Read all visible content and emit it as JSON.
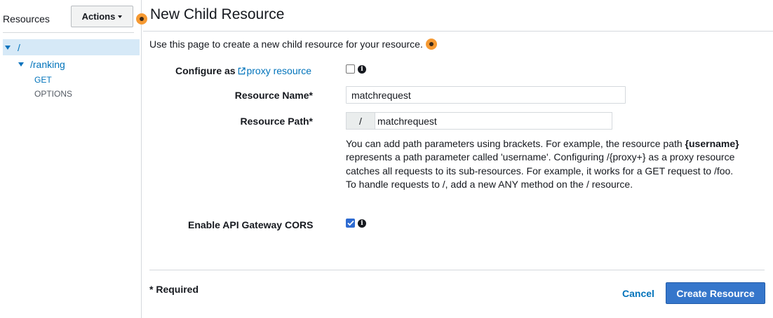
{
  "sidebar": {
    "title": "Resources",
    "actions_label": "Actions",
    "tree": {
      "root_label": "/",
      "child_label": "/ranking",
      "methods": [
        "GET",
        "OPTIONS"
      ]
    }
  },
  "main": {
    "title": "New Child Resource",
    "description": "Use this page to create a new child resource for your resource.",
    "proxy": {
      "label": "Configure as",
      "link_label": "proxy resource",
      "checked": false
    },
    "resource_name": {
      "label": "Resource Name*",
      "value": "matchrequest"
    },
    "resource_path": {
      "label": "Resource Path*",
      "prefix": "/",
      "value": "matchrequest"
    },
    "help": {
      "part1": "You can add path parameters using brackets. For example, the resource path ",
      "bold": "{username}",
      "part2": " represents a path parameter called 'username'. Configuring /{proxy+} as a proxy resource catches all requests to its sub-resources. For example, it works for a GET request to /foo. To handle requests to /, add a new ANY method on the / resource."
    },
    "cors": {
      "label": "Enable API Gateway CORS",
      "checked": true
    },
    "required_note": "* Required",
    "cancel_label": "Cancel",
    "create_label": "Create Resource"
  },
  "icons": {
    "info": "info-icon",
    "external_link": "external-link-icon",
    "help_dot": "orange-info-dot"
  },
  "colors": {
    "link": "#0073bb",
    "primary_button": "#3576cb",
    "selected_row": "#d6e9f7",
    "help_dot": "#f69a33"
  }
}
